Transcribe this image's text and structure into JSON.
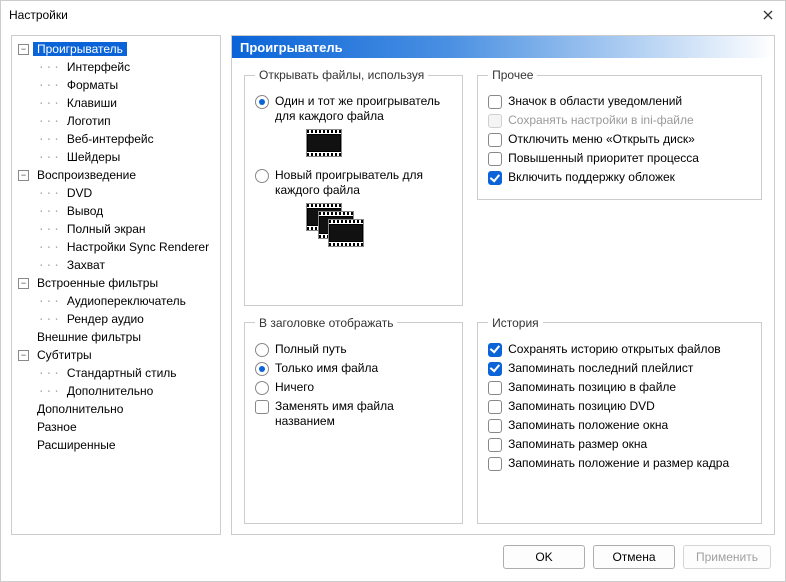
{
  "window": {
    "title": "Настройки"
  },
  "tree": {
    "n0": {
      "label": "Проигрыватель",
      "selected": true
    },
    "n0_0": {
      "label": "Интерфейс"
    },
    "n0_1": {
      "label": "Форматы"
    },
    "n0_2": {
      "label": "Клавиши"
    },
    "n0_3": {
      "label": "Логотип"
    },
    "n0_4": {
      "label": "Веб-интерфейс"
    },
    "n0_5": {
      "label": "Шейдеры"
    },
    "n1": {
      "label": "Воспроизведение"
    },
    "n1_0": {
      "label": "DVD"
    },
    "n1_1": {
      "label": "Вывод"
    },
    "n1_2": {
      "label": "Полный экран"
    },
    "n1_3": {
      "label": "Настройки Sync Renderer"
    },
    "n1_4": {
      "label": "Захват"
    },
    "n2": {
      "label": "Встроенные фильтры"
    },
    "n2_0": {
      "label": "Аудиопереключатель"
    },
    "n2_1": {
      "label": "Рендер аудио"
    },
    "n3": {
      "label": "Внешние фильтры"
    },
    "n4": {
      "label": "Субтитры"
    },
    "n4_0": {
      "label": "Стандартный стиль"
    },
    "n4_1": {
      "label": "Дополнительно"
    },
    "n5": {
      "label": "Дополнительно"
    },
    "n6": {
      "label": "Разное"
    },
    "n7": {
      "label": "Расширенные"
    }
  },
  "section": {
    "title": "Проигрыватель"
  },
  "groups": {
    "open": {
      "legend": "Открывать файлы, используя",
      "radio_same": "Один и тот же проигрыватель для каждого файла",
      "radio_new": "Новый проигрыватель для каждого файла"
    },
    "titlebar": {
      "legend": "В заголовке отображать",
      "radio_full": "Полный путь",
      "radio_name": "Только имя файла",
      "radio_none": "Ничего",
      "check_replace": "Заменять имя файла названием"
    },
    "other": {
      "legend": "Прочее",
      "check_tray": "Значок в области уведомлений",
      "check_ini": "Сохранять настройки в ini-файле",
      "check_disablemenu": "Отключить меню «Открыть диск»",
      "check_priority": "Повышенный приоритет процесса",
      "check_covers": "Включить поддержку обложек"
    },
    "history": {
      "legend": "История",
      "check_history": "Сохранять историю открытых файлов",
      "check_playlist": "Запоминать последний плейлист",
      "check_filepos": "Запоминать позицию в файле",
      "check_dvdpos": "Запоминать позицию DVD",
      "check_winpos": "Запоминать положение окна",
      "check_winsize": "Запоминать размер окна",
      "check_pnspos": "Запоминать положение и размер кадра"
    }
  },
  "buttons": {
    "ok": "OK",
    "cancel": "Отмена",
    "apply": "Применить"
  }
}
